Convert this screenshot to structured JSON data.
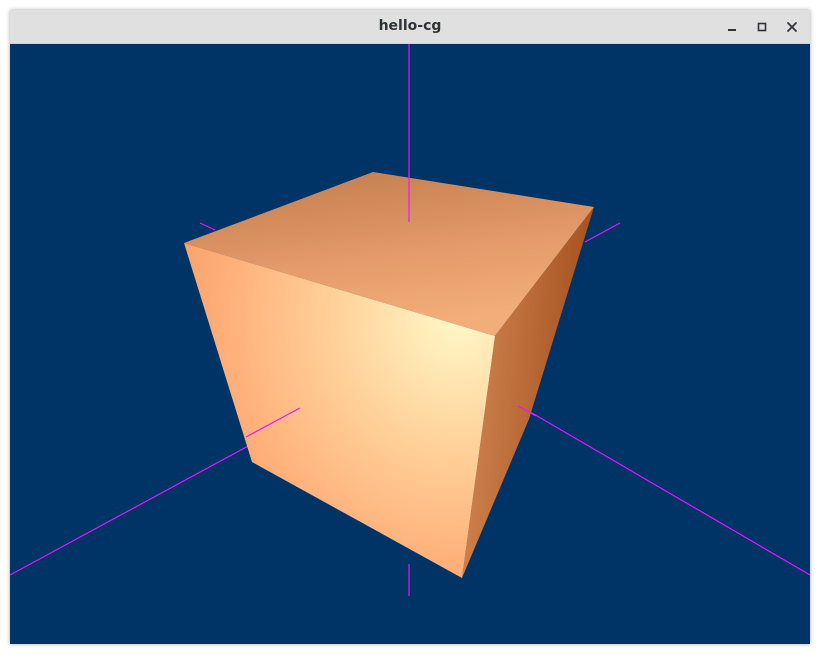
{
  "window": {
    "title": "hello-cg"
  },
  "controls": {
    "minimize_icon": "minimize-icon",
    "maximize_icon": "maximize-icon",
    "close_icon": "close-icon"
  },
  "scene": {
    "background_color": "#003366",
    "axis_color": "#e815ff",
    "cube_color": "#ffab73",
    "cube_highlight_color": "#fff8c8"
  }
}
